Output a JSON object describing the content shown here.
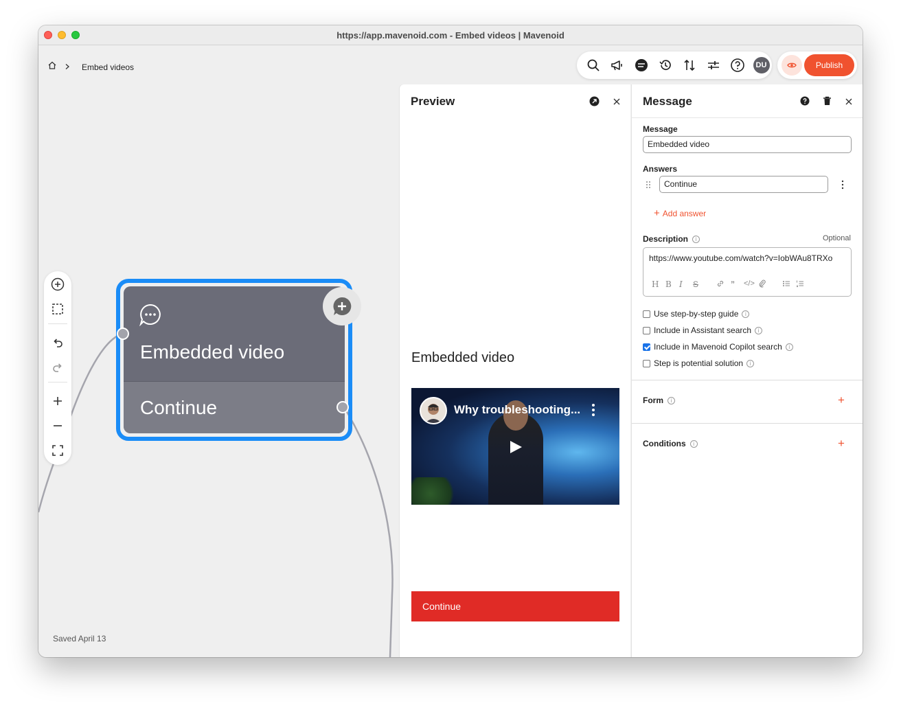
{
  "window": {
    "title": "https://app.mavenoid.com - Embed videos | Mavenoid"
  },
  "breadcrumb": {
    "current": "Embed videos"
  },
  "toolbar": {
    "icons": [
      "search-icon",
      "megaphone-icon",
      "chat-icon",
      "history-icon",
      "sort-icon",
      "sliders-icon",
      "help-icon"
    ],
    "avatar": "DU",
    "publish_label": "Publish"
  },
  "canvas": {
    "saved_text": "Saved April 13",
    "node": {
      "title": "Embedded video",
      "answer": "Continue"
    }
  },
  "preview": {
    "title": "Preview",
    "message": "Embedded video",
    "video_title": "Why troubleshooting...",
    "continue_label": "Continue"
  },
  "message_panel": {
    "title": "Message",
    "message_label": "Message",
    "message_value": "Embedded video",
    "answers_label": "Answers",
    "answer_value": "Continue",
    "add_answer": "Add answer",
    "description_label": "Description",
    "optional": "Optional",
    "description_value": "https://www.youtube.com/watch?v=IobWAu8TRXo",
    "checkboxes": [
      {
        "label": "Use step-by-step guide",
        "checked": false
      },
      {
        "label": "Include in Assistant search",
        "checked": false
      },
      {
        "label": "Include in Mavenoid Copilot search",
        "checked": true
      },
      {
        "label": "Step is potential solution",
        "checked": false
      }
    ],
    "form_label": "Form",
    "conditions_label": "Conditions"
  },
  "colors": {
    "accent": "#f0522f",
    "selection": "#1a8cf7",
    "cta": "#e02b26"
  }
}
